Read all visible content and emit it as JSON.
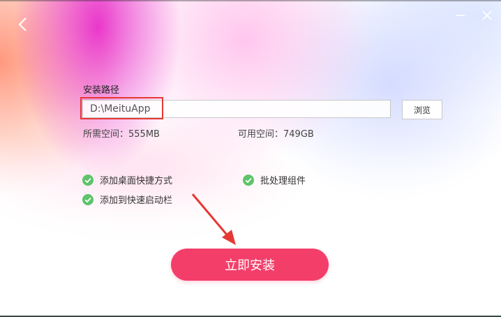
{
  "window": {
    "back_icon": "chevron-left-icon",
    "minimize_icon": "minimize-icon",
    "close_icon": "close-icon"
  },
  "install": {
    "path_label": "安装路径",
    "path_value": "D:\\MeituApp",
    "browse_label": "浏览",
    "required_space": "所需空间：555MB",
    "available_space": "可用空间：749GB",
    "options": [
      {
        "label": "添加桌面快捷方式",
        "checked": true
      },
      {
        "label": "批处理组件",
        "checked": true
      },
      {
        "label": "添加到快速启动栏",
        "checked": true
      }
    ],
    "install_button": "立即安装"
  },
  "colors": {
    "accent": "#f43e6a",
    "check": "#5cc46a",
    "highlight_box": "#e53935"
  }
}
